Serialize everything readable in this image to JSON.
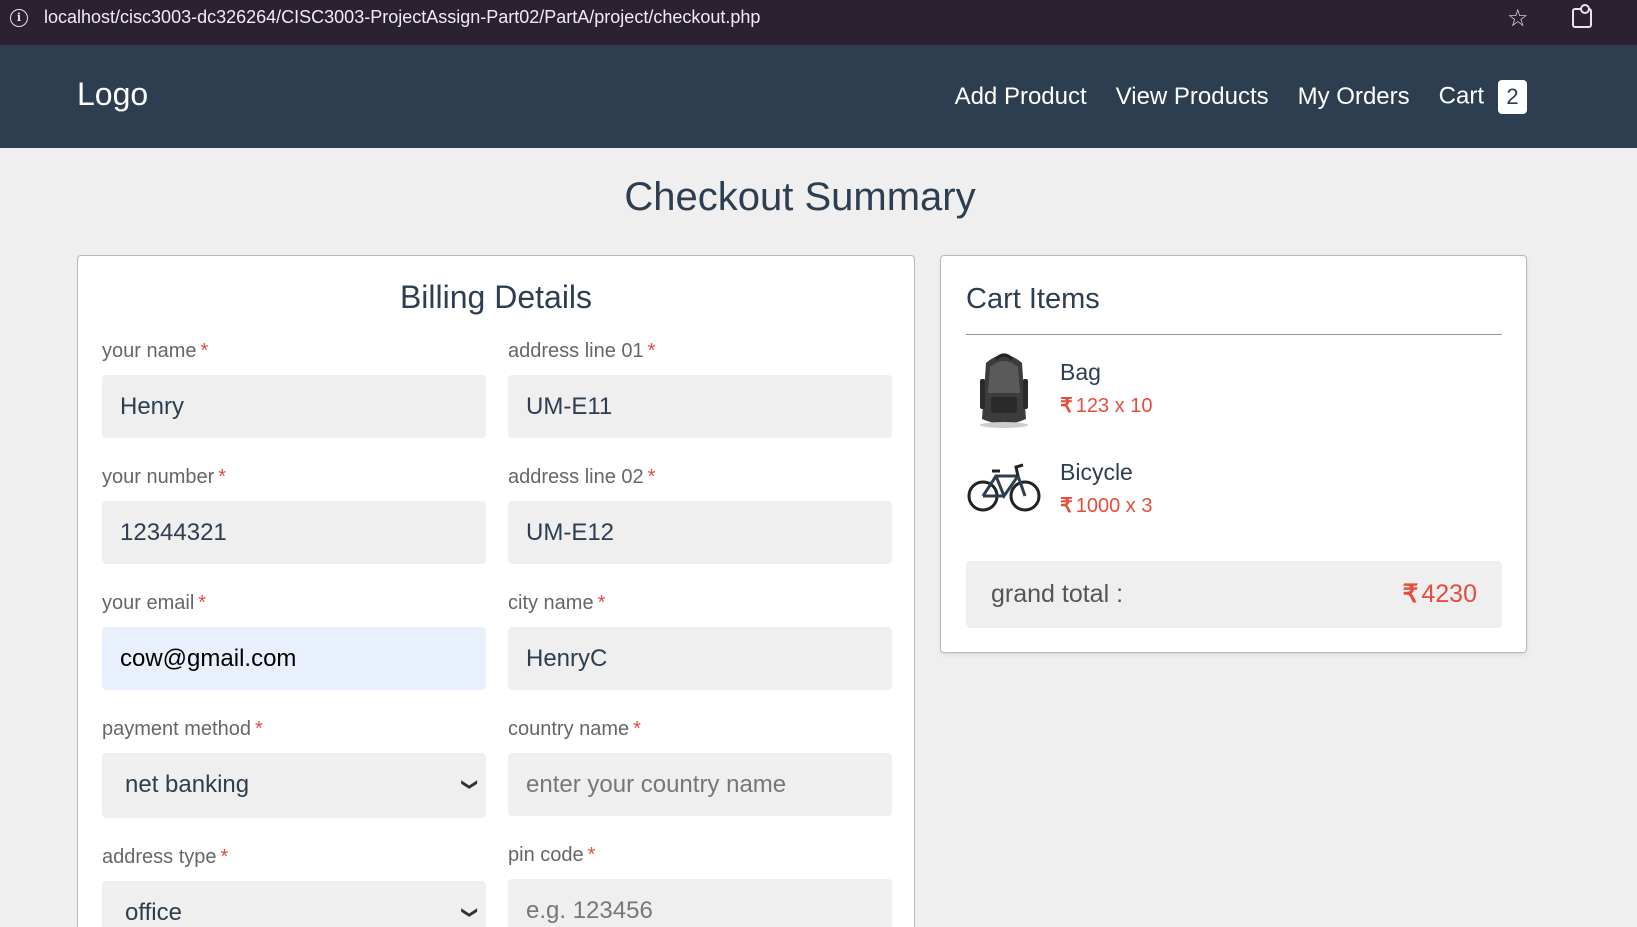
{
  "browser": {
    "url": "localhost/cisc3003-dc326264/CISC3003-ProjectAssign-Part02/PartA/project/checkout.php",
    "info_icon": "i"
  },
  "header": {
    "logo": "Logo",
    "nav": [
      "Add Product",
      "View Products",
      "My Orders",
      "Cart"
    ],
    "cart_count": "2"
  },
  "page_title": "Checkout Summary",
  "billing": {
    "title": "Billing Details",
    "required_mark": "*",
    "fields": {
      "name": {
        "label": "your name",
        "value": "Henry"
      },
      "number": {
        "label": "your number",
        "value": "12344321"
      },
      "email": {
        "label": "your email",
        "value": "cow@gmail.com"
      },
      "payment": {
        "label": "payment method",
        "value": "net banking"
      },
      "address_type": {
        "label": "address type",
        "value": "office"
      },
      "address1": {
        "label": "address line 01",
        "value": "UM-E11"
      },
      "address2": {
        "label": "address line 02",
        "value": "UM-E12"
      },
      "city": {
        "label": "city name",
        "value": "HenryC"
      },
      "country": {
        "label": "country name",
        "placeholder": "enter your country name"
      },
      "pin": {
        "label": "pin code",
        "placeholder": "e.g. 123456"
      }
    }
  },
  "cart": {
    "title": "Cart Items",
    "currency": "₹",
    "items": [
      {
        "name": "Bag",
        "price": "123 x 10"
      },
      {
        "name": "Bicycle",
        "price": "1000 x 3"
      }
    ],
    "grand_total_label": "grand total :",
    "grand_total_value": "4230"
  },
  "colors": {
    "header_bg": "#2c3e50",
    "accent": "#e74c3c",
    "page_bg": "#efefef"
  }
}
